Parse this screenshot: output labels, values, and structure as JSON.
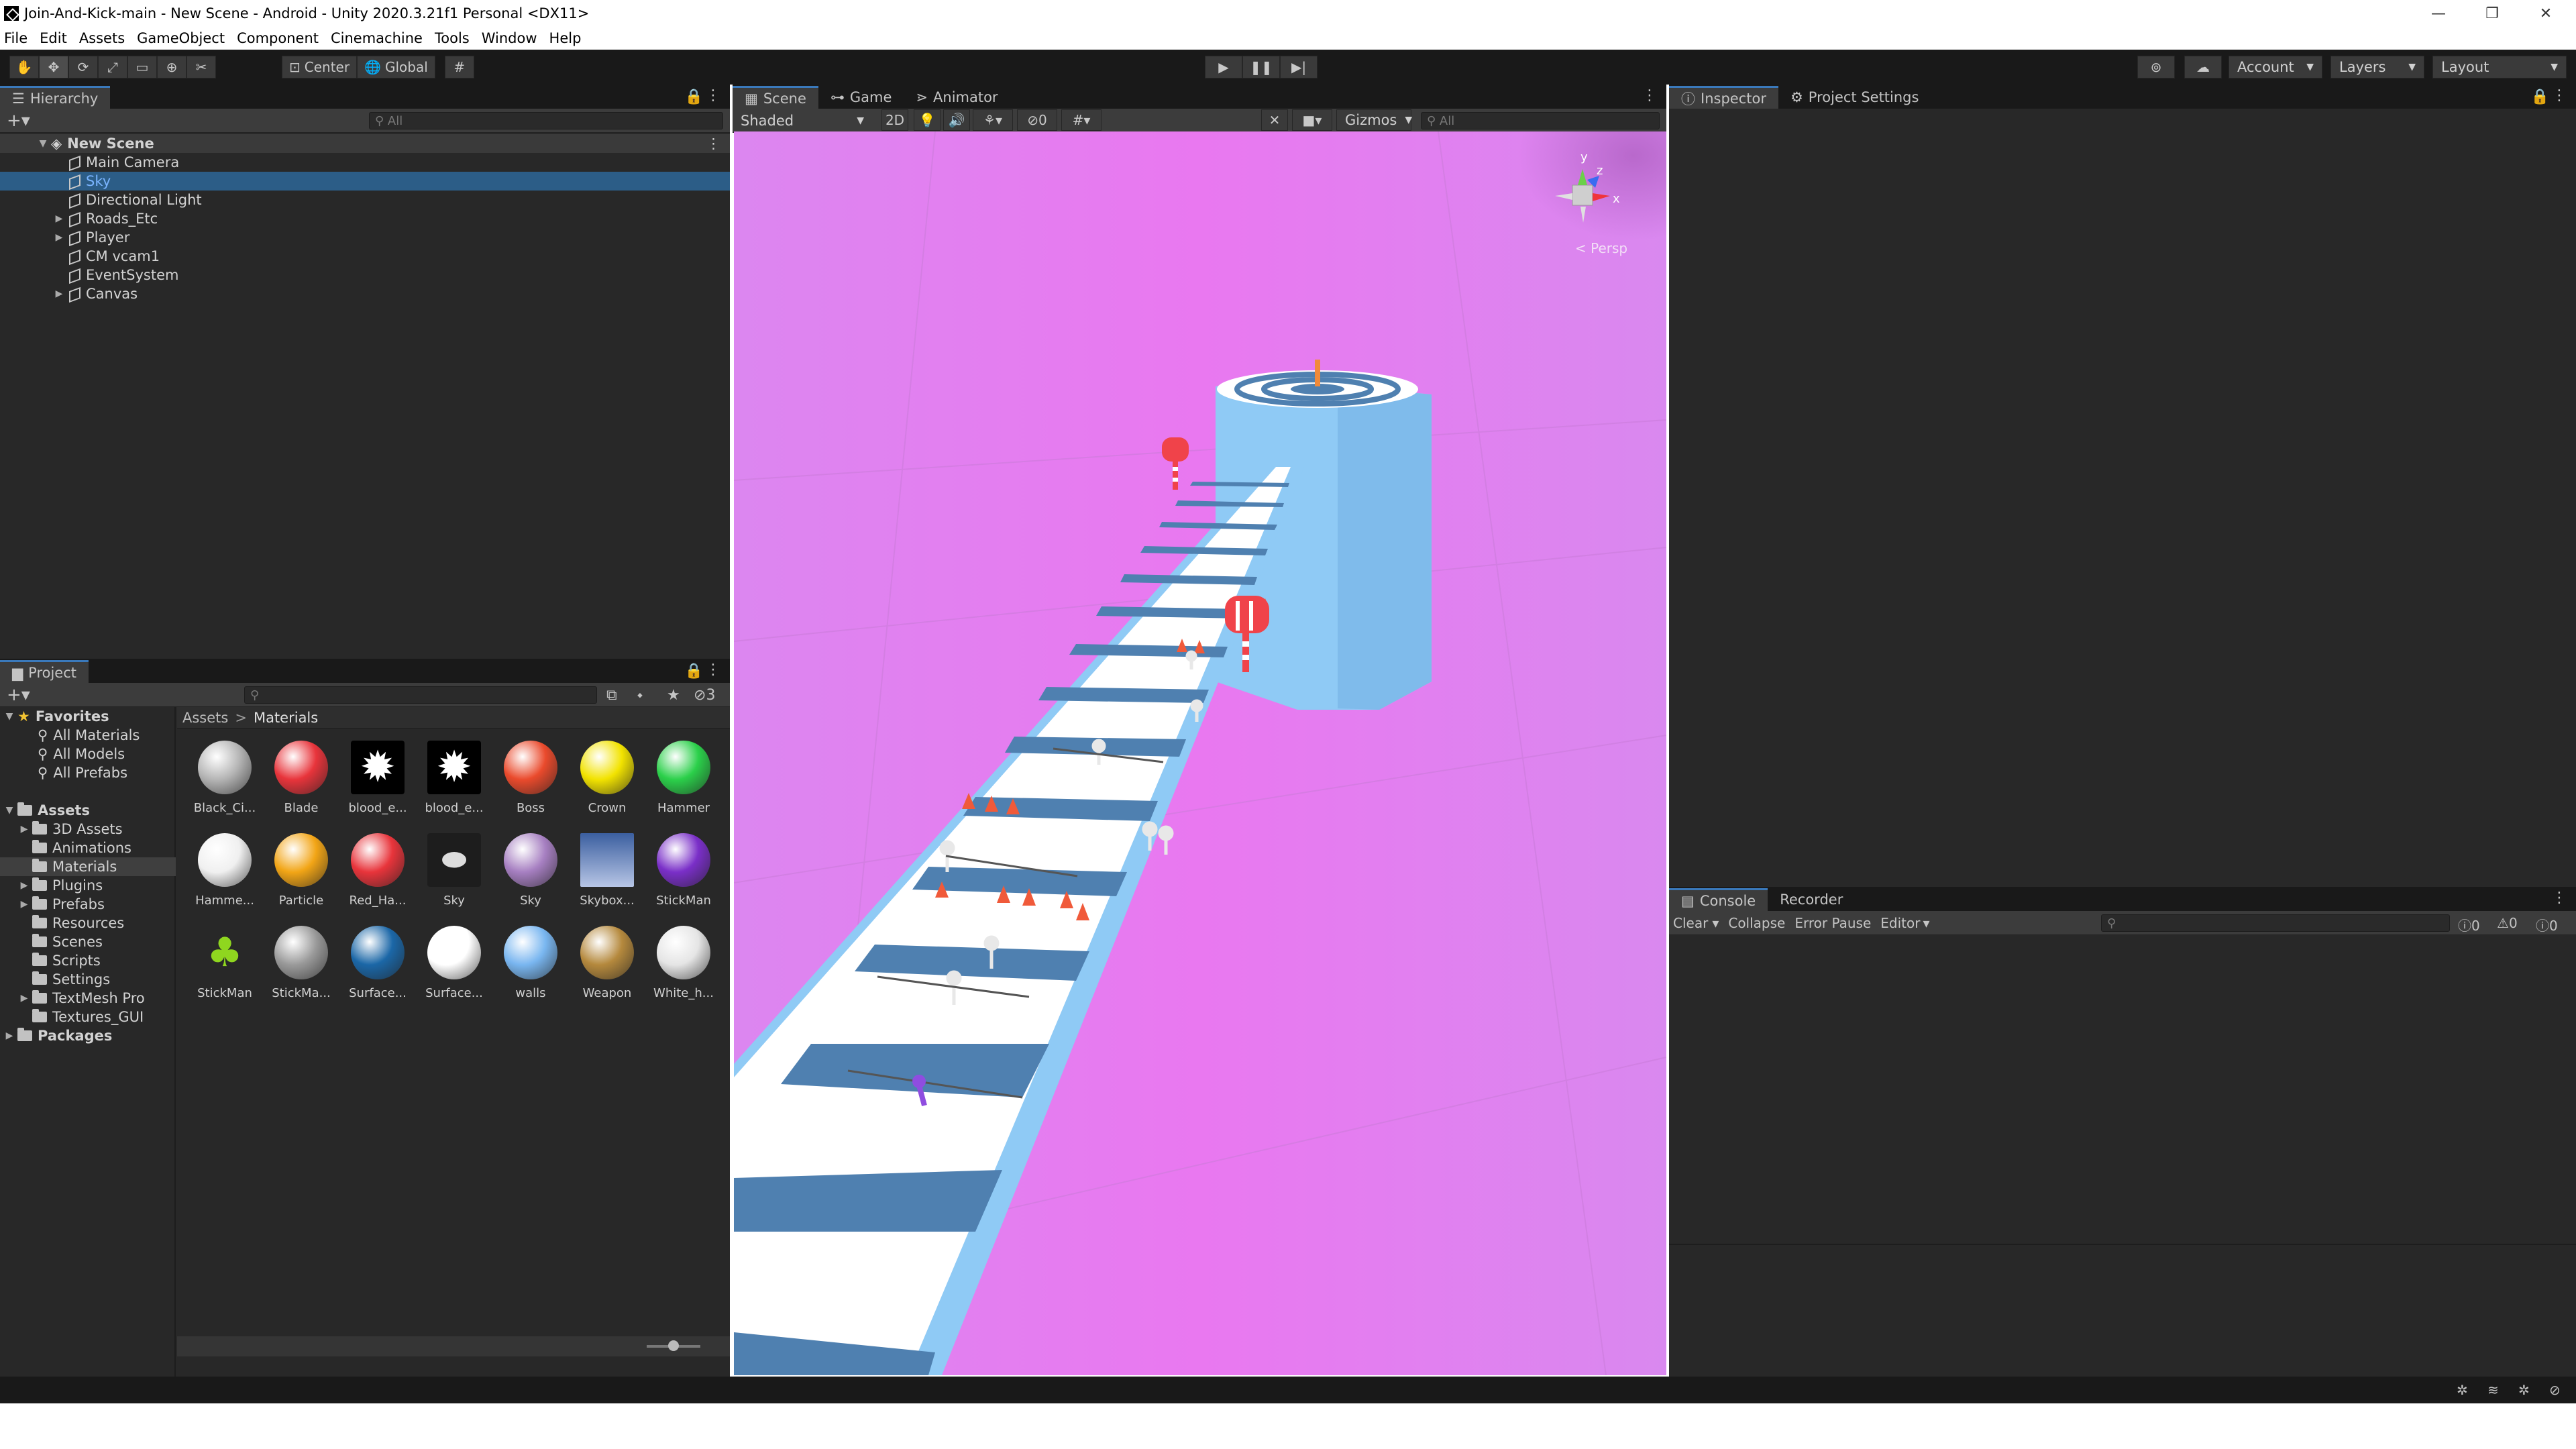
{
  "window": {
    "title": "Join-And-Kick-main - New Scene - Android - Unity 2020.3.21f1 Personal <DX11>",
    "controls": [
      "—",
      "❐",
      "✕"
    ]
  },
  "menu": [
    "File",
    "Edit",
    "Assets",
    "GameObject",
    "Component",
    "Cinemachine",
    "Tools",
    "Window",
    "Help"
  ],
  "toolbar": {
    "pivot": "Center",
    "space": "Global",
    "account": "Account",
    "layers": "Layers",
    "layout": "Layout"
  },
  "hierarchy": {
    "tab": "Hierarchy",
    "search_placeholder": "All",
    "scene_name": "New Scene",
    "items": [
      {
        "label": "Main Camera",
        "expandable": false,
        "selected": false
      },
      {
        "label": "Sky",
        "expandable": false,
        "selected": true
      },
      {
        "label": "Directional Light",
        "expandable": false,
        "selected": false
      },
      {
        "label": "Roads_Etc",
        "expandable": true,
        "selected": false
      },
      {
        "label": "Player",
        "expandable": true,
        "selected": false
      },
      {
        "label": "CM vcam1",
        "expandable": false,
        "selected": false
      },
      {
        "label": "EventSystem",
        "expandable": false,
        "selected": false
      },
      {
        "label": "Canvas",
        "expandable": true,
        "selected": false
      }
    ]
  },
  "project": {
    "tab": "Project",
    "hidden_count": "3",
    "favorites_label": "Favorites",
    "favorites": [
      "All Materials",
      "All Models",
      "All Prefabs"
    ],
    "assets_label": "Assets",
    "folders": [
      "3D Assets",
      "Animations",
      "Materials",
      "Plugins",
      "Prefabs",
      "Resources",
      "Scenes",
      "Scripts",
      "Settings",
      "TextMesh Pro",
      "Textures_GUI"
    ],
    "selected_folder": "Materials",
    "packages_label": "Packages",
    "breadcrumb": [
      "Assets",
      "Materials"
    ],
    "breadcrumb_sep": ">",
    "materials": [
      {
        "name": "Black_Ci...",
        "color": "#b5b5b5"
      },
      {
        "name": "Blade",
        "color": "#e8343b"
      },
      {
        "name": "blood_e...",
        "color": "#ffffff",
        "kind": "splat"
      },
      {
        "name": "blood_e...",
        "color": "#ffffff",
        "kind": "splat"
      },
      {
        "name": "Boss",
        "color": "#ea4a2c"
      },
      {
        "name": "Crown",
        "color": "#f2e300"
      },
      {
        "name": "Hammer",
        "color": "#2bd04a"
      },
      {
        "name": "Hamme...",
        "color": "#f0f0f0"
      },
      {
        "name": "Particle",
        "color": "#f2a516"
      },
      {
        "name": "Red_Ha...",
        "color": "#e8343b"
      },
      {
        "name": "Sky",
        "color": "#2a2a2a",
        "kind": "skyicon"
      },
      {
        "name": "Sky",
        "color": "#a67fc1"
      },
      {
        "name": "Skybox...",
        "color": "#6c86b5",
        "kind": "box"
      },
      {
        "name": "StickMan",
        "color": "#7a2fc8"
      },
      {
        "name": "StickMan",
        "color": "#8fd61f",
        "kind": "shape"
      },
      {
        "name": "StickMa...",
        "color": "#9a9a9a"
      },
      {
        "name": "Surface...",
        "color": "#1b67a7"
      },
      {
        "name": "Surface...",
        "color": "#ffffff"
      },
      {
        "name": "walls",
        "color": "#79b6f0"
      },
      {
        "name": "Weapon",
        "color": "#b5893d"
      },
      {
        "name": "White_h...",
        "color": "#e5e5e5"
      }
    ]
  },
  "scene_view": {
    "tabs": [
      "Scene",
      "Game",
      "Animator"
    ],
    "active_tab": "Scene",
    "draw_mode": "Shaded",
    "mode_2d": "2D",
    "hidden_count": "0",
    "gizmos": "Gizmos",
    "search_placeholder": "All",
    "projection": "Persp",
    "gizmo_axes": {
      "y": "y",
      "z": "z",
      "x": "x"
    },
    "sky_color": "#e37ef0",
    "road_blue": "#4f80b0",
    "wall_color": "#8fcaf5"
  },
  "inspector": {
    "tabs": [
      "Inspector",
      "Project Settings"
    ]
  },
  "console": {
    "tabs": [
      "Console",
      "Recorder"
    ],
    "buttons": [
      "Clear",
      "Collapse",
      "Error Pause",
      "Editor"
    ],
    "counts": {
      "log": "0",
      "warn": "0",
      "error": "0"
    }
  }
}
